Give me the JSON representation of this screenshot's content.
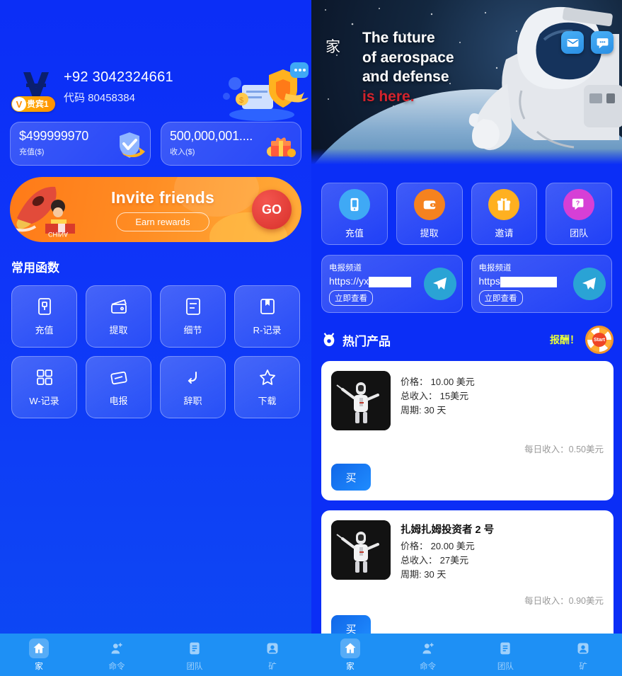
{
  "colors": {
    "brand_blue": "#0b2ef6",
    "tabbar_blue": "#1e90f5",
    "accent_orange": "#ff8c23",
    "reward_yellow": "#e9ff3a",
    "danger_red": "#d4232c"
  },
  "left": {
    "account": {
      "avatar_name": "user-logo-avatar",
      "vip_badge": "贵宾1",
      "phone": "+92 3042324661",
      "code": "代码 80458384"
    },
    "stats": [
      {
        "value": "$499999970",
        "label": "充值($)",
        "icon": "shield-check-icon"
      },
      {
        "value": "500,000,001....",
        "label": "收入($)",
        "icon": "gift-box-icon"
      }
    ],
    "invite": {
      "title": "Invite friends",
      "subtitle": "Earn rewards",
      "button": "GO"
    },
    "section_title": "常用函数",
    "functions": [
      {
        "label": "充值",
        "icon": "deposit-screen-icon"
      },
      {
        "label": "提取",
        "icon": "wallet-icon"
      },
      {
        "label": "细节",
        "icon": "details-document-icon"
      },
      {
        "label": "R-记录",
        "icon": "bookmark-record-icon"
      },
      {
        "label": "W-记录",
        "icon": "grid-record-icon"
      },
      {
        "label": "电报",
        "icon": "telegram-card-icon"
      },
      {
        "label": "辞职",
        "icon": "resign-undo-icon"
      },
      {
        "label": "下载",
        "icon": "star-download-icon"
      }
    ],
    "tabs": [
      {
        "label": "家",
        "icon": "home-icon",
        "active": true
      },
      {
        "label": "命令",
        "icon": "add-user-icon",
        "active": false
      },
      {
        "label": "团队",
        "icon": "document-icon",
        "active": false
      },
      {
        "label": "矿",
        "icon": "profile-icon",
        "active": false
      }
    ]
  },
  "right": {
    "hero": {
      "home_label": "家",
      "line1": "The future",
      "line2": "of aerospace",
      "line3": "and defense",
      "line4": "is here.",
      "icons": [
        {
          "name": "mail-icon"
        },
        {
          "name": "chat-bubble-icon"
        }
      ]
    },
    "quick_actions": [
      {
        "label": "充值",
        "icon": "phone-deposit-icon",
        "color": "#3fa9f5"
      },
      {
        "label": "提取",
        "icon": "wallet-withdraw-icon",
        "color": "#f5821f"
      },
      {
        "label": "邀请",
        "icon": "gift-invite-icon",
        "color": "#ffb020"
      },
      {
        "label": "团队",
        "icon": "question-team-icon",
        "color": "#d63fd6"
      }
    ],
    "telegram_cards": [
      {
        "title": "电报频道",
        "url_visible": "https://yx",
        "url_redacted": true,
        "button": "立即查看",
        "icon": "telegram-plane-icon"
      },
      {
        "title": "电报频道",
        "url_visible": "https",
        "url_redacted": true,
        "button": "立即查看",
        "icon": "telegram-plane-icon"
      }
    ],
    "hot": {
      "icon": "bell-hot-icon",
      "title": "热门产品",
      "reward_label": "报酬！",
      "wheel_label": "Start"
    },
    "products": [
      {
        "name": "",
        "image": "robot-thumbnail",
        "price_label": "价格：",
        "price_value": "10.00 美元",
        "total_label": "总收入：",
        "total_value": "15美元",
        "cycle_label": "周期:",
        "cycle_value": "30 天",
        "daily": "每日收入：0.50美元",
        "buy_label": "买"
      },
      {
        "name": "扎姆扎姆投资者 2 号",
        "image": "robot-thumbnail",
        "price_label": "价格：",
        "price_value": "20.00 美元",
        "total_label": "总收入：",
        "total_value": "27美元",
        "cycle_label": "周期:",
        "cycle_value": "30 天",
        "daily": "每日收入：0.90美元",
        "buy_label": "买"
      }
    ],
    "tabs": [
      {
        "label": "家",
        "icon": "home-icon",
        "active": true
      },
      {
        "label": "命令",
        "icon": "add-user-icon",
        "active": false
      },
      {
        "label": "团队",
        "icon": "document-icon",
        "active": false
      },
      {
        "label": "矿",
        "icon": "profile-icon",
        "active": false
      }
    ]
  }
}
